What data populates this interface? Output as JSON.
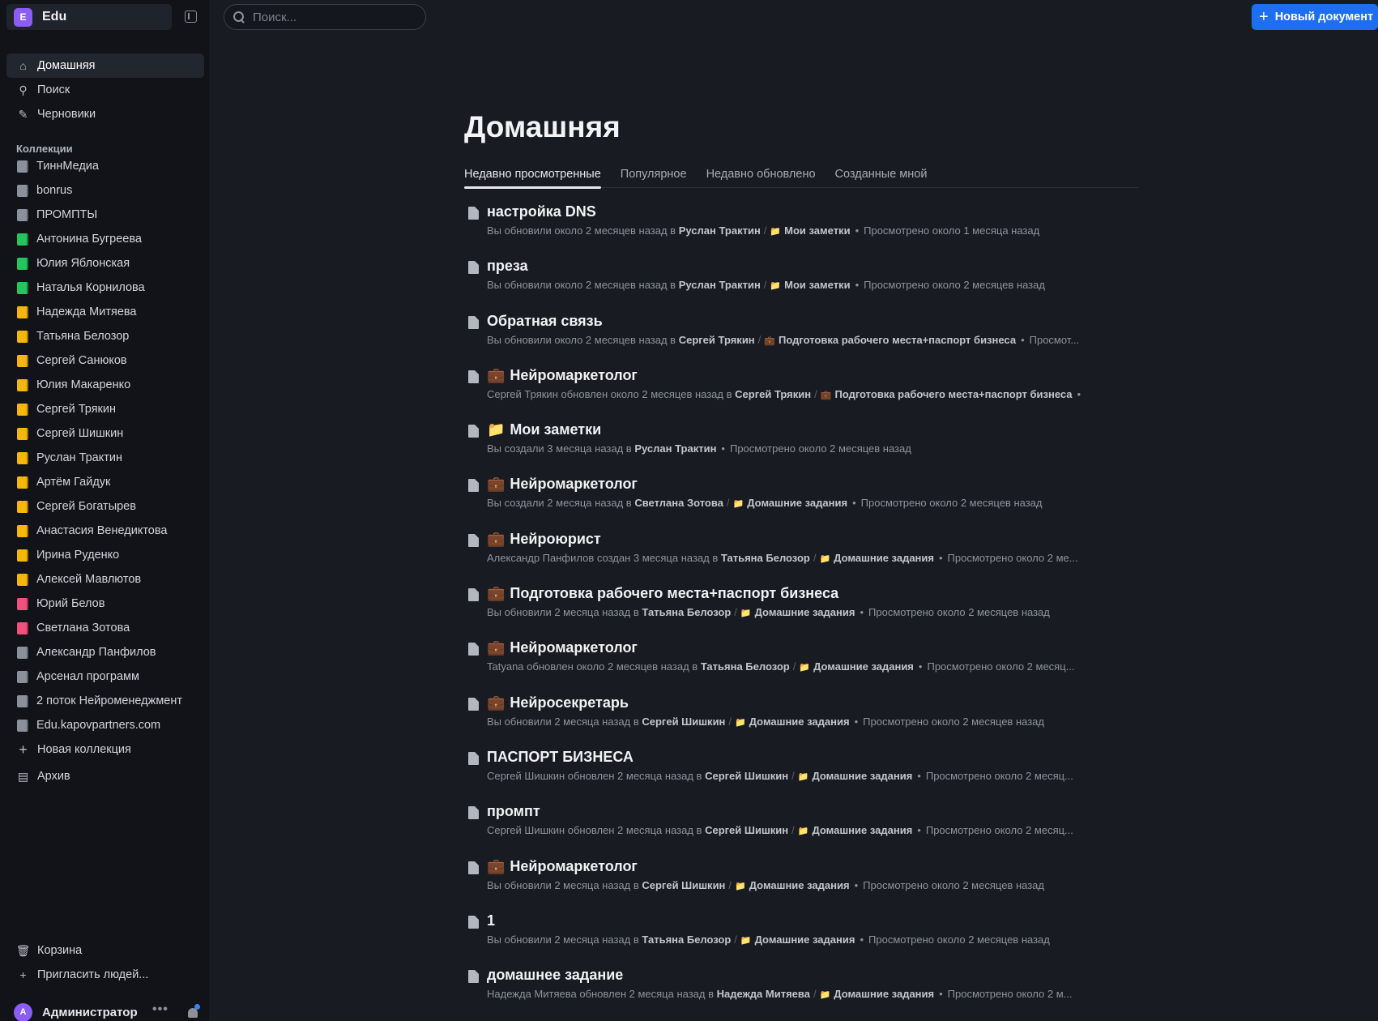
{
  "team": {
    "initial": "E",
    "name": "Edu"
  },
  "search": {
    "placeholder": "Поиск..."
  },
  "toolbar": {
    "new_doc_label": "Новый документ"
  },
  "nav": [
    {
      "label": "Домашняя",
      "icon": "home-icon",
      "glyph": "⌂"
    },
    {
      "label": "Поиск",
      "icon": "search-icon",
      "glyph": "⚲"
    },
    {
      "label": "Черновики",
      "icon": "edit-icon",
      "glyph": "✎"
    }
  ],
  "collections_label": "Коллекции",
  "collections": [
    {
      "label": "ТиннМедиа",
      "color": "#8a919c"
    },
    {
      "label": "bonrus",
      "color": "#8a919c"
    },
    {
      "label": "ПРОМПТЫ",
      "color": "#8a919c"
    },
    {
      "label": "Антонина Бугреева",
      "color": "#22c55e"
    },
    {
      "label": "Юлия Яблонская",
      "color": "#22c55e"
    },
    {
      "label": "Наталья Корнилова",
      "color": "#22c55e"
    },
    {
      "label": "Надежда Митяева",
      "color": "#f5b70b"
    },
    {
      "label": "Татьяна Белозор",
      "color": "#f5b70b"
    },
    {
      "label": "Сергей Санюков",
      "color": "#f5b70b"
    },
    {
      "label": "Юлия Макаренко",
      "color": "#f5b70b"
    },
    {
      "label": "Сергей Трякин",
      "color": "#f5b70b"
    },
    {
      "label": "Сергей Шишкин",
      "color": "#f5b70b"
    },
    {
      "label": "Руслан Трактин",
      "color": "#f5b70b"
    },
    {
      "label": "Артём Гайдук",
      "color": "#f5b70b"
    },
    {
      "label": "Сергей Богатырев",
      "color": "#f5b70b"
    },
    {
      "label": "Анастасия Венедиктова",
      "color": "#f5b70b"
    },
    {
      "label": "Ирина Руденко",
      "color": "#f5b70b"
    },
    {
      "label": "Алексей Мавлютов",
      "color": "#f5b70b"
    },
    {
      "label": "Юрий Белов",
      "color": "#f0507a"
    },
    {
      "label": "Светлана Зотова",
      "color": "#f0507a"
    },
    {
      "label": "Александр Панфилов",
      "color": "#8a919c"
    },
    {
      "label": "Арсенал программ",
      "color": "#8a919c"
    },
    {
      "label": "2 поток Нейроменеджмент",
      "color": "#8a919c"
    },
    {
      "label": "Edu.kapovpartners.com",
      "color": "#8a919c"
    }
  ],
  "new_collection_label": "Новая коллекция",
  "archive_label": "Архив",
  "trash_label": "Корзина",
  "invite_label": "Пригласить людей...",
  "profile": {
    "initial": "A",
    "name": "Администратор"
  },
  "page_title": "Домашняя",
  "tabs": [
    "Недавно просмотренные",
    "Популярное",
    "Недавно обновлено",
    "Созданные мной"
  ],
  "documents": [
    {
      "emoji": "",
      "title": "настройка DNS",
      "action": "Вы обновили около 2 месяцев назад в",
      "collection": "Руслан Трактин",
      "folder": "Мои заметки",
      "folder_emoji": "📁",
      "viewed": "Просмотрено около 1 месяца назад"
    },
    {
      "emoji": "",
      "title": "преза",
      "action": "Вы обновили около 2 месяцев назад в",
      "collection": "Руслан Трактин",
      "folder": "Мои заметки",
      "folder_emoji": "📁",
      "viewed": "Просмотрено около 2 месяцев назад"
    },
    {
      "emoji": "",
      "title": "Обратная связь",
      "action": "Вы обновили около 2 месяцев назад в",
      "collection": "Сергей Трякин",
      "folder": "Подготовка рабочего места+паспорт бизнеса",
      "folder_emoji": "💼",
      "viewed": "Просмот..."
    },
    {
      "emoji": "💼",
      "title": "Нейромаркетолог",
      "action": "Сергей Трякин обновлен около 2 месяцев назад в",
      "collection": "Сергей Трякин",
      "folder": "Подготовка рабочего места+паспорт бизнеса",
      "folder_emoji": "💼",
      "viewed": ""
    },
    {
      "emoji": "📁",
      "title": "Мои заметки",
      "action": "Вы создали 3 месяца назад в",
      "collection": "Руслан Трактин",
      "folder": "",
      "folder_emoji": "",
      "viewed": "Просмотрено около 2 месяцев назад"
    },
    {
      "emoji": "💼",
      "title": "Нейромаркетолог",
      "action": "Вы создали 2 месяца назад в",
      "collection": "Светлана Зотова",
      "folder": "Домашние задания",
      "folder_emoji": "📁",
      "viewed": "Просмотрено около 2 месяцев назад"
    },
    {
      "emoji": "💼",
      "title": "Нейроюрист",
      "action": "Александр Панфилов создан 3 месяца назад в",
      "collection": "Татьяна Белозор",
      "folder": "Домашние задания",
      "folder_emoji": "📁",
      "viewed": "Просмотрено около 2 ме..."
    },
    {
      "emoji": "💼",
      "title": "Подготовка рабочего места+паспорт бизнеса",
      "action": "Вы обновили 2 месяца назад в",
      "collection": "Татьяна Белозор",
      "folder": "Домашние задания",
      "folder_emoji": "📁",
      "viewed": "Просмотрено около 2 месяцев назад"
    },
    {
      "emoji": "💼",
      "title": "Нейромаркетолог",
      "action": "Tatyana обновлен около 2 месяцев назад в",
      "collection": "Татьяна Белозор",
      "folder": "Домашние задания",
      "folder_emoji": "📁",
      "viewed": "Просмотрено около 2 месяц..."
    },
    {
      "emoji": "💼",
      "title": "Нейросекретарь",
      "action": "Вы обновили 2 месяца назад в",
      "collection": "Сергей Шишкин",
      "folder": "Домашние задания",
      "folder_emoji": "📁",
      "viewed": "Просмотрено около 2 месяцев назад"
    },
    {
      "emoji": "",
      "title": "ПАСПОРТ БИЗНЕСА",
      "action": "Сергей Шишкин обновлен 2 месяца назад в",
      "collection": "Сергей Шишкин",
      "folder": "Домашние задания",
      "folder_emoji": "📁",
      "viewed": "Просмотрено около 2 месяц..."
    },
    {
      "emoji": "",
      "title": "промпт",
      "action": "Сергей Шишкин обновлен 2 месяца назад в",
      "collection": "Сергей Шишкин",
      "folder": "Домашние задания",
      "folder_emoji": "📁",
      "viewed": "Просмотрено около 2 месяц..."
    },
    {
      "emoji": "💼",
      "title": "Нейромаркетолог",
      "action": "Вы обновили 2 месяца назад в",
      "collection": "Сергей Шишкин",
      "folder": "Домашние задания",
      "folder_emoji": "📁",
      "viewed": "Просмотрено около 2 месяцев назад"
    },
    {
      "emoji": "",
      "title": "1",
      "action": "Вы обновили 2 месяца назад в",
      "collection": "Татьяна Белозор",
      "folder": "Домашние задания",
      "folder_emoji": "📁",
      "viewed": "Просмотрено около 2 месяцев назад"
    },
    {
      "emoji": "",
      "title": "домашнее задание",
      "action": "Надежда Митяева обновлен 2 месяца назад в",
      "collection": "Надежда Митяева",
      "folder": "Домашние задания",
      "folder_emoji": "📁",
      "viewed": "Просмотрено около 2 м..."
    }
  ]
}
